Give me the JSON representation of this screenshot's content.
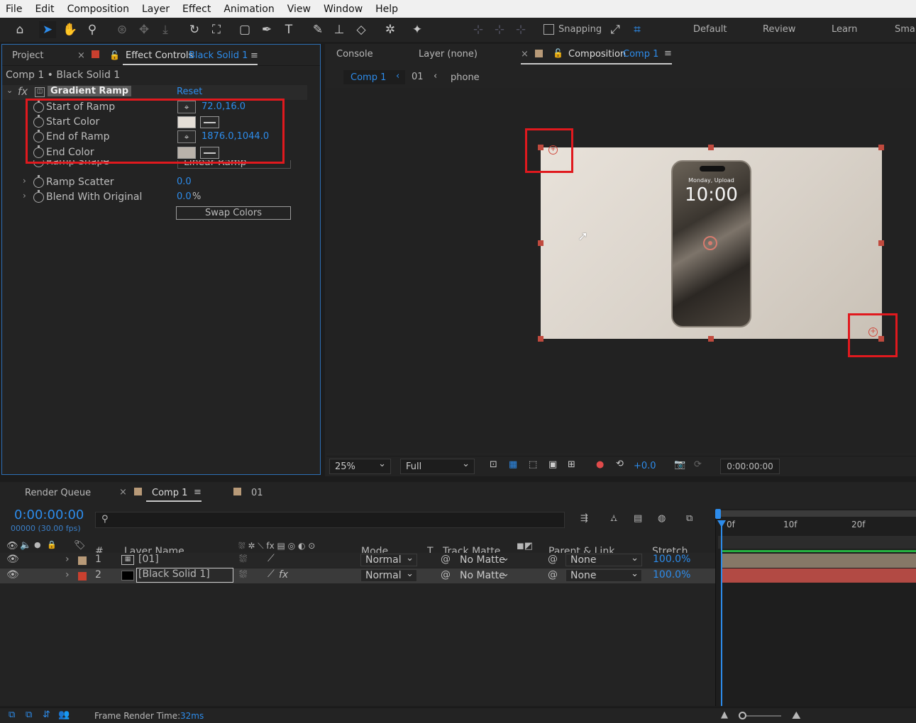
{
  "menu": [
    "File",
    "Edit",
    "Composition",
    "Layer",
    "Effect",
    "Animation",
    "View",
    "Window",
    "Help"
  ],
  "toolbar": {
    "snapping": "Snapping",
    "workspaces": [
      "Default",
      "Review",
      "Learn",
      "Smal"
    ]
  },
  "left_panel": {
    "tab_project": "Project",
    "tab_effect_controls": "Effect Controls",
    "tab_effect_layer": "Black Solid 1",
    "breadcrumb": "Comp 1 • Black Solid 1",
    "effect_name": "Gradient Ramp",
    "reset": "Reset",
    "properties": [
      {
        "name": "Start of Ramp",
        "value": "72.0,16.0"
      },
      {
        "name": "Start Color",
        "color": "#e4ded6"
      },
      {
        "name": "End of Ramp",
        "value": "1876.0,1044.0"
      },
      {
        "name": "End Color",
        "color": "#b9b2aa"
      },
      {
        "name": "Ramp Shape",
        "value": "Linear Ramp"
      },
      {
        "name": "Ramp Scatter",
        "value": "0.0"
      },
      {
        "name": "Blend With Original",
        "value": "0.0",
        "unit": "%"
      }
    ],
    "swap_colors": "Swap Colors"
  },
  "comp_panel": {
    "tab_console": "Console",
    "tab_layer": "Layer (none)",
    "tab_composition": "Composition",
    "tab_comp_name": "Comp 1",
    "crumbs": [
      "Comp 1",
      "01",
      "phone"
    ],
    "phone_date": "Monday, Upload",
    "phone_time": "10:00",
    "zoom": "25%",
    "resolution": "Full",
    "exposure": "+0.0",
    "timecode": "0:00:00:00"
  },
  "timeline": {
    "tab_render_queue": "Render Queue",
    "tab_comp": "Comp 1",
    "tab_01": "01",
    "current_time": "0:00:00:00",
    "frame_info": "00000 (30.00 fps)",
    "search_placeholder": "",
    "ruler": [
      "0f",
      "10f",
      "20f"
    ],
    "columns": {
      "num": "#",
      "layer_name": "Layer Name",
      "mode": "Mode",
      "t": "T",
      "track_matte": "Track Matte",
      "parent": "Parent & Link",
      "stretch": "Stretch"
    },
    "layers": [
      {
        "num": "1",
        "name": "[01]",
        "mode": "Normal",
        "matte": "No Matte",
        "parent": "None",
        "stretch": "100.0%",
        "label": "#b89a78"
      },
      {
        "num": "2",
        "name": "[Black Solid 1]",
        "mode": "Normal",
        "matte": "No Matte",
        "parent": "None",
        "stretch": "100.0%",
        "label": "#c9402f"
      }
    ]
  },
  "status": {
    "label": "Frame Render Time:",
    "value": "32ms"
  }
}
